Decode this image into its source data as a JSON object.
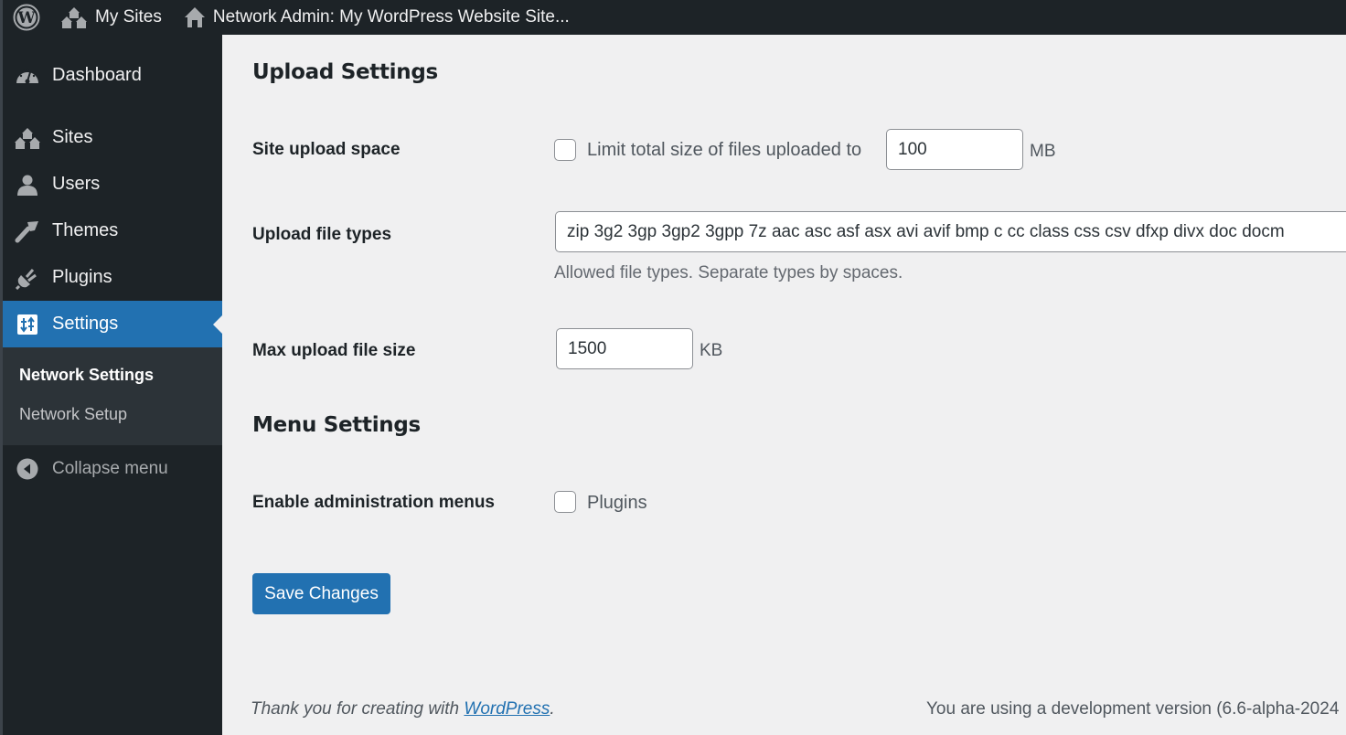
{
  "adminbar": {
    "wp_logo": "wordpress-logo-icon",
    "my_sites": "My Sites",
    "network_admin": "Network Admin: My WordPress Website Site..."
  },
  "sidebar": {
    "items": [
      {
        "label": "Dashboard",
        "icon": "dashboard-icon"
      },
      {
        "label": "Sites",
        "icon": "sites-icon"
      },
      {
        "label": "Users",
        "icon": "users-icon"
      },
      {
        "label": "Themes",
        "icon": "themes-icon"
      },
      {
        "label": "Plugins",
        "icon": "plugins-icon"
      },
      {
        "label": "Settings",
        "icon": "settings-icon",
        "current": true
      }
    ],
    "submenu": [
      {
        "label": "Network Settings",
        "current": true
      },
      {
        "label": "Network Setup"
      }
    ],
    "collapse": "Collapse menu"
  },
  "main": {
    "upload_section_title": "Upload Settings",
    "site_upload_space": {
      "label": "Site upload space",
      "checkbox_label": "Limit total size of files uploaded to",
      "checked": false,
      "value": "100",
      "unit": "MB"
    },
    "upload_file_types": {
      "label": "Upload file types",
      "value": "zip 3g2 3gp 3gp2 3gpp 7z aac asc asf asx avi avif bmp c cc class css csv dfxp divx doc docm",
      "description": "Allowed file types. Separate types by spaces."
    },
    "max_upload_file_size": {
      "label": "Max upload file size",
      "value": "1500",
      "unit": "KB"
    },
    "menu_section_title": "Menu Settings",
    "enable_admin_menus": {
      "label": "Enable administration menus",
      "checkbox_label": "Plugins",
      "checked": false
    },
    "save_button": "Save Changes"
  },
  "footer": {
    "thank_you_prefix": "Thank you for creating with ",
    "wordpress_link": "WordPress",
    "thank_you_suffix": ".",
    "version_text": "You are using a development version (6.6-alpha-2024"
  },
  "colors": {
    "accent": "#2271b1",
    "adminbar_bg": "#1d2327",
    "submenu_bg": "#2c3338",
    "page_bg": "#f0f0f1"
  }
}
